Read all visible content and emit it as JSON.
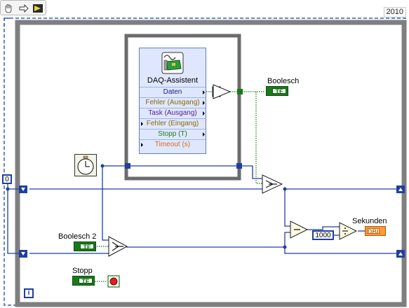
{
  "toolbar": {
    "run_mode_icon": "hand-icon",
    "step_icon": "arrow-right-icon",
    "run_icon": "run-arrow-icon"
  },
  "version_label": "2010",
  "daq": {
    "title": "DAQ-Assistent",
    "rows": [
      {
        "label": "Daten",
        "color": "#1a1a8a"
      },
      {
        "label": "Fehler (Ausgang)",
        "color": "#8a6a00"
      },
      {
        "label": "Task (Ausgang)",
        "color": "#5a1a8a"
      },
      {
        "label": "Fehler (Eingang)",
        "color": "#8a6a00"
      },
      {
        "label": "Stopp (T)",
        "color": "#1a7a1a"
      },
      {
        "label": "Timeout (s)",
        "color": "#d96a10"
      }
    ]
  },
  "labels": {
    "boolesch": "Boolesch",
    "boolesch2": "Boolesch 2",
    "stopp": "Stopp",
    "sekunden": "Sekunden"
  },
  "constants": {
    "zero": "0",
    "thousand": "1000",
    "tf": "TF",
    "dbl": "DBL",
    "iteration": "i"
  },
  "colors": {
    "loop_frame": "#7f7f7f",
    "wire_blue": "#1f3fa0",
    "wire_green": "#1a7a1a",
    "seq_frame": "#6b6b6b"
  }
}
